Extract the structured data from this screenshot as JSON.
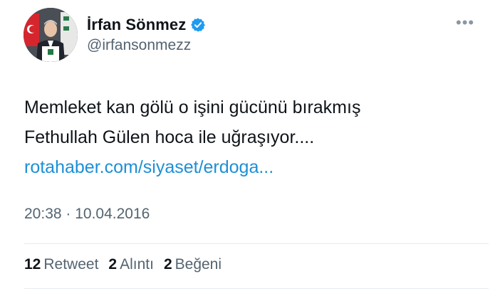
{
  "author": {
    "display_name": "İrfan Sönmez",
    "handle": "@irfansonmezz"
  },
  "menu": {
    "more_label": "•••"
  },
  "tweet": {
    "line1": "Memleket kan gölü o işini gücünü bırakmış",
    "line2": "Fethullah Gülen hoca ile uğraşıyor....",
    "link": "rotahaber.com/siyaset/erdoga..."
  },
  "meta": {
    "timestamp": "20:38 · 10.04.2016"
  },
  "stats": {
    "retweets": {
      "count": "12",
      "label": "Retweet"
    },
    "quotes": {
      "count": "2",
      "label": "Alıntı"
    },
    "likes": {
      "count": "2",
      "label": "Beğeni"
    }
  },
  "colors": {
    "link": "#1d8fd6",
    "verified_badge": "#1d9bf0",
    "secondary_text": "#536471",
    "primary_text": "#0f1419"
  },
  "icons": {
    "verified": "verified-badge-icon",
    "more": "more-icon"
  }
}
